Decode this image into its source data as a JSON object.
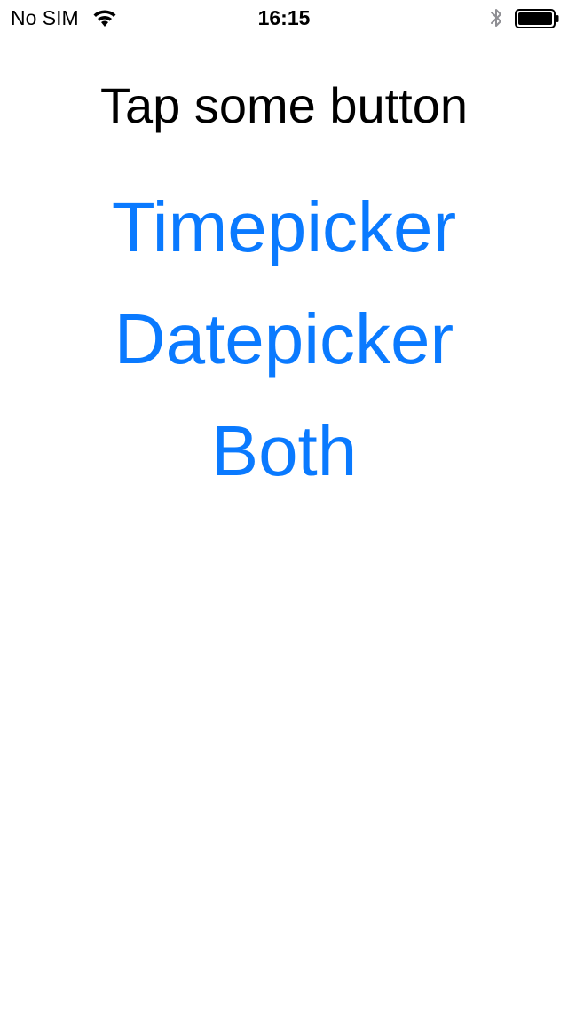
{
  "status_bar": {
    "carrier": "No SIM",
    "time": "16:15",
    "icons": [
      "wifi-icon",
      "bluetooth-icon",
      "battery-icon"
    ]
  },
  "prompt": "Tap some button",
  "buttons": {
    "timepicker": "Timepicker",
    "datepicker": "Datepicker",
    "both": "Both"
  },
  "colors": {
    "accent": "#0a7aff",
    "text": "#000000",
    "background": "#ffffff"
  }
}
